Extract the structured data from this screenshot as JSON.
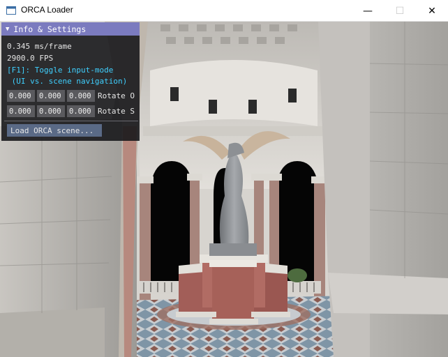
{
  "window": {
    "title": "ORCA Loader",
    "controls": {
      "minimize": "—",
      "maximize": "☐",
      "close": "✕"
    },
    "icon": "app-window-icon"
  },
  "panel": {
    "header": "Info & Settings",
    "header_icon": "collapse-triangle-icon",
    "ms_per_frame": "0.345 ms/frame",
    "fps": "2900.0 FPS",
    "hint_line1": "[F1]: Toggle input-mode",
    "hint_line2": " (UI vs. scene navigation)",
    "rotate_row1": {
      "v1": "0.000",
      "v2": "0.000",
      "v3": "0.000",
      "label": "Rotate O"
    },
    "rotate_row2": {
      "v1": "0.000",
      "v2": "0.000",
      "v3": "0.000",
      "label": "Rotate S"
    },
    "load_button": "Load ORCA scene...",
    "colors": {
      "header": "#7b7bbf",
      "text_accent": "#3fd0ff",
      "button": "#5a6a86",
      "field": "#5a5a5e"
    }
  },
  "scene": {
    "description_icon": "3d-scene-viewport"
  }
}
